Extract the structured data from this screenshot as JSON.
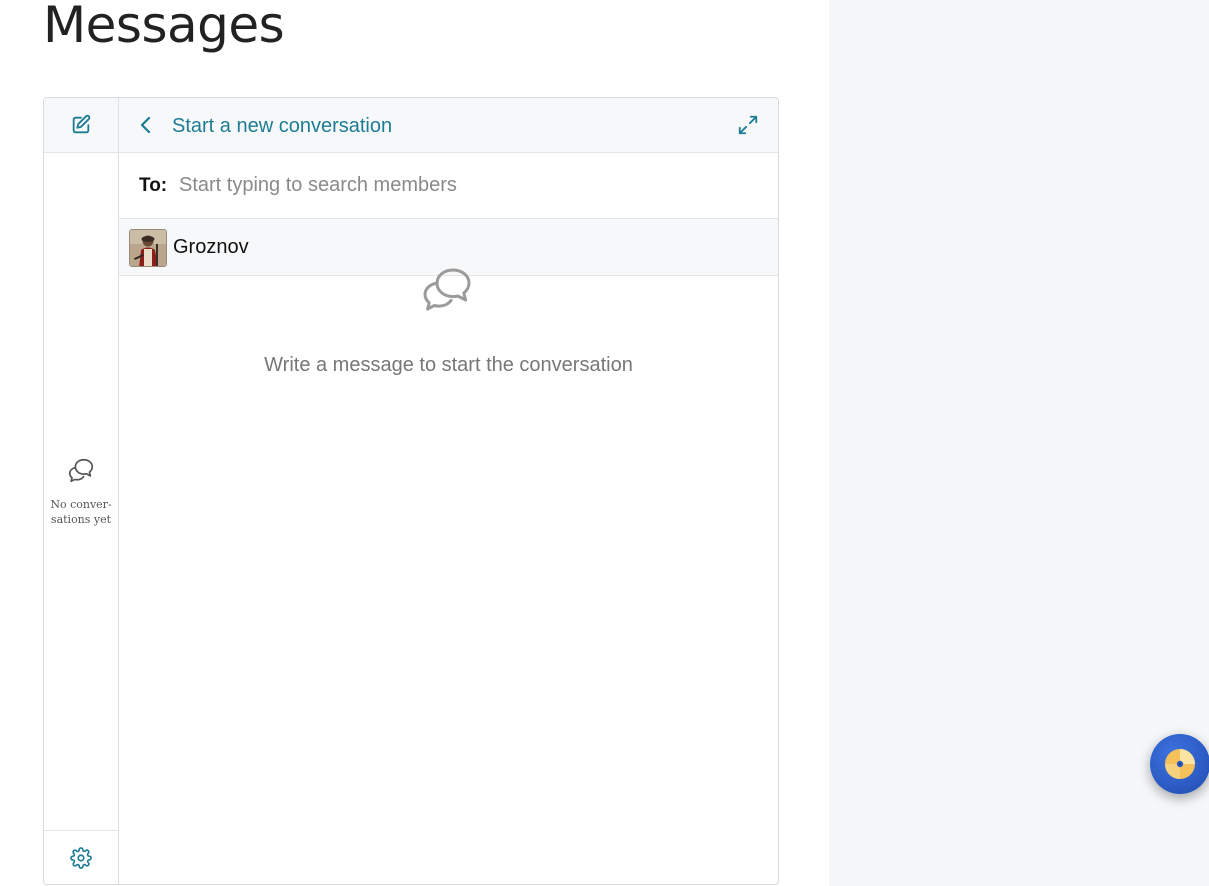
{
  "page": {
    "title": "Messages"
  },
  "sidebar": {
    "compose_icon": "compose-pencil-icon",
    "empty_icon": "chat-bubbles-icon",
    "empty_text": "No conver- sations yet",
    "settings_icon": "gear-icon"
  },
  "header": {
    "back_icon": "chevron-left-icon",
    "title": "Start a new conversation",
    "expand_icon": "expand-arrows-icon"
  },
  "recipient": {
    "label": "To:",
    "placeholder": "Start typing to search members",
    "value": ""
  },
  "suggestions": [
    {
      "name": "Groznov",
      "avatar": "soldier-portrait-avatar"
    }
  ],
  "conversation": {
    "empty_icon": "chat-bubbles-icon",
    "empty_text": "Write a message to start the conversation"
  },
  "floating_button": {
    "icon": "disc-icon"
  },
  "colors": {
    "accent": "#1d7c94",
    "side_panel": "#f6f7f9",
    "fab": "#2c5bc4"
  }
}
